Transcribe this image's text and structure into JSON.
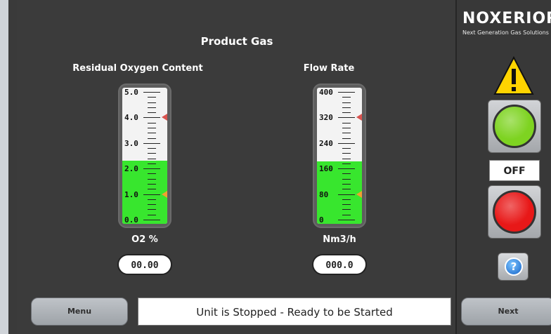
{
  "header": {
    "title": "Product Gas"
  },
  "gauges": {
    "oxygen": {
      "label": "Residual Oxygen Content",
      "ticks": [
        "5.0",
        "4.0",
        "3.0",
        "2.0",
        "1.0",
        "0.0"
      ],
      "min": 0,
      "max": 5,
      "fill_value": 2.3,
      "high_marker": 4.0,
      "low_marker": 1.0,
      "unit": "O2 %",
      "readout": "00.00"
    },
    "flow": {
      "label": "Flow Rate",
      "ticks": [
        "400",
        "320",
        "240",
        "160",
        "80",
        "0"
      ],
      "min": 0,
      "max": 400,
      "fill_value": 183,
      "high_marker": 320,
      "low_marker": 80,
      "unit": "Nm3/h",
      "readout": "000.0"
    }
  },
  "footer": {
    "menu_label": "Menu",
    "status_text": "Unit is Stopped - Ready to be Started",
    "next_label": "Next"
  },
  "side": {
    "brand_name": "NOXERIOR",
    "brand_tagline": "Next Generation Gas Solutions",
    "state_text": "OFF",
    "start_color": "#7ed321",
    "stop_color": "#e81818",
    "warning_icon": "warning-triangle-icon",
    "help_icon": "help-icon"
  },
  "colors": {
    "fill": "#38e62e",
    "high_marker": "#d9534f",
    "low_marker": "#f0a030"
  }
}
